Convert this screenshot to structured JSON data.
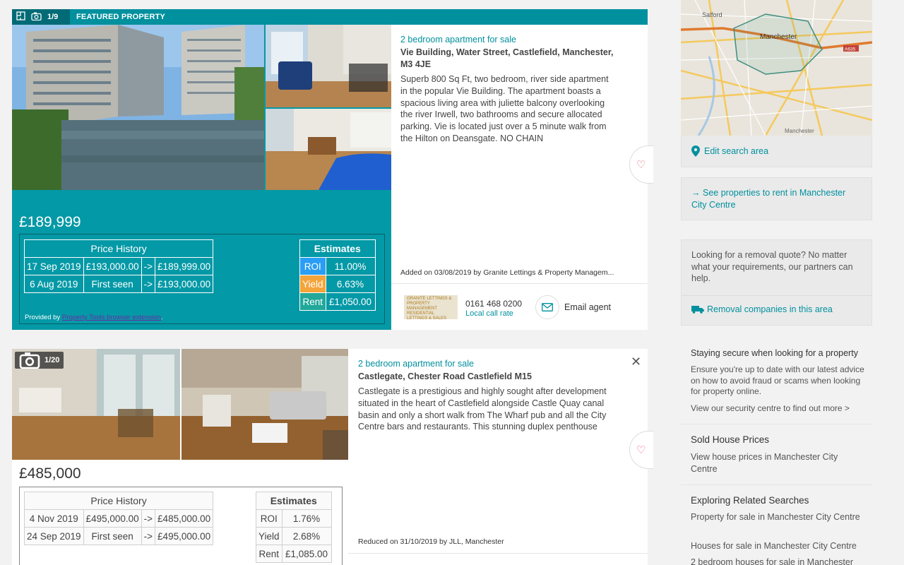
{
  "listing1": {
    "photo_count": "1/9",
    "featured_label": "FEATURED PROPERTY",
    "price": "£189,999",
    "type_link": "2 bedroom apartment for sale",
    "address": "Vie Building, Water Street, Castlefield, Manchester, M3 4JE",
    "description": "Superb 800 Sq Ft, two bedroom, river side apartment in the popular Vie Building. The apartment boasts a spacious living area with juliette balcony overlooking the river Irwell, two bathrooms and secure allocated parking. Vie is located just over a 5 minute walk from the Hilton on Deansgate. NO CHAIN",
    "added": "Added on 03/08/2019 by Granite Lettings & Property Managem...",
    "agent_logo_text": "GRANITE LETTINGS & PROPERTY MANAGEMENT RESIDENTIAL LETTINGS & SALES",
    "phone": "0161 468 0200",
    "phone_note": "Local call rate",
    "email_label": "Email agent",
    "price_history": {
      "title": "Price History",
      "rows": [
        {
          "date": "17 Sep 2019",
          "from": "£193,000.00",
          "arrow": "->",
          "to": "£189,999.00"
        },
        {
          "date": "6 Aug 2019",
          "from": "First seen",
          "arrow": "->",
          "to": "£193,000.00"
        }
      ]
    },
    "estimates": {
      "title": "Estimates",
      "roi_label": "ROI",
      "roi": "11.00%",
      "yield_label": "Yield",
      "yield": "6.63%",
      "rent_label": "Rent",
      "rent": "£1,050.00"
    },
    "provided_by": "Provided by",
    "provided_link": "Property Tools browser extension",
    "provided_tail": "."
  },
  "listing2": {
    "photo_count": "1/20",
    "price": "£485,000",
    "type_link": "2 bedroom apartment for sale",
    "address": "Castlegate, Chester Road Castlefield M15",
    "description": "Castlegate is a prestigious and highly sought after development situated in the heart of Castlefield alongside Castle Quay canal basin and only a short walk from The Wharf pub and all the City Centre bars and restaurants. This stunning duplex penthouse",
    "reduced": "Reduced on 31/10/2019 by JLL, Manchester",
    "close": "✕",
    "price_history": {
      "title": "Price History",
      "rows": [
        {
          "date": "4 Nov 2019",
          "from": "£495,000.00",
          "arrow": "->",
          "to": "£485,000.00"
        },
        {
          "date": "24 Sep 2019",
          "from": "First seen",
          "arrow": "->",
          "to": "£495,000.00"
        }
      ]
    },
    "estimates": {
      "title": "Estimates",
      "roi_label": "ROI",
      "roi": "1.76%",
      "yield_label": "Yield",
      "yield": "2.68%",
      "rent_label": "Rent",
      "rent": "£1,085.00"
    }
  },
  "sidebar": {
    "map_labels": {
      "salford": "Salford",
      "manchester": "Manchester",
      "road": "A635",
      "bottom": "Manchester"
    },
    "edit_search": "Edit search area",
    "rent_link": "See properties to rent in Manchester City Centre",
    "removal_text": "Looking for a removal quote? No matter what your requirements, our partners can help.",
    "removal_link": "Removal companies in this area",
    "secure_title": "Staying secure when looking for a property",
    "secure_text": "Ensure you're up to date with our latest advice on how to avoid fraud or scams when looking for property online.",
    "secure_link": "View our security centre to find out more >",
    "sold_title": "Sold House Prices",
    "sold_link": "View house prices in Manchester City Centre",
    "related_title": "Exploring Related Searches",
    "related_links": [
      "Property for sale in Manchester City Centre",
      "Houses for sale in Manchester City Centre",
      "2 bedroom houses for sale in Manchester"
    ]
  },
  "colors": {
    "teal": "#0499a6",
    "teal_dark": "#006b76",
    "roi": "#2a9df4",
    "yield": "#f4a43a",
    "rent": "#21a89a"
  }
}
